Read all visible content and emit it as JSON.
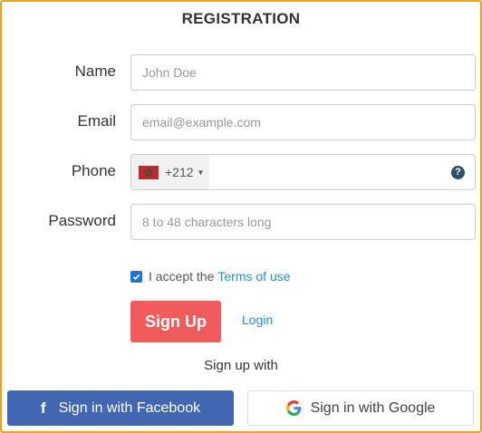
{
  "form": {
    "title": "REGISTRATION",
    "name": {
      "label": "Name",
      "placeholder": "John Doe",
      "value": ""
    },
    "email": {
      "label": "Email",
      "placeholder": "email@example.com",
      "value": ""
    },
    "phone": {
      "label": "Phone",
      "country_code": "+212",
      "value": "",
      "help_icon": "question-circle-icon",
      "flag": "morocco-flag-icon"
    },
    "password": {
      "label": "Password",
      "placeholder": "8 to 48 characters long",
      "value": ""
    },
    "terms": {
      "checked": true,
      "text": "I accept the",
      "link_text": "Terms of use"
    },
    "signup_label": "Sign Up",
    "login_label": "Login",
    "signup_with": "Sign up with",
    "facebook_label": "Sign in with Facebook",
    "google_label": "Sign in with Google"
  },
  "colors": {
    "frame_border": "#f0a020",
    "signup_button": "#f25b5b",
    "facebook_button": "#4267b2",
    "link": "#1a98c7",
    "checkbox": "#1e73d8"
  }
}
